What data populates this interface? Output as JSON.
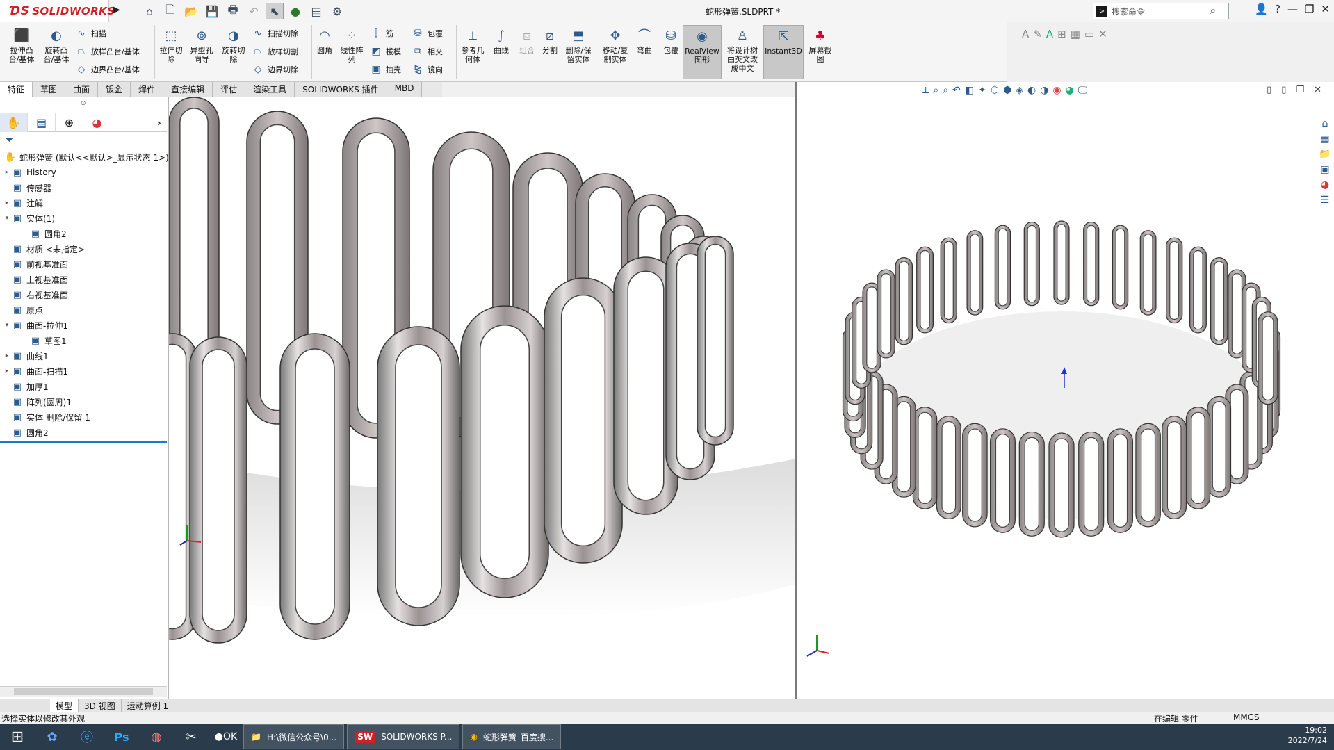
{
  "app": {
    "logo": "SOLIDWORKS",
    "doc_title": "蛇形弹簧.SLDPRT *"
  },
  "search": {
    "placeholder": "搜索命令"
  },
  "ribbon": {
    "extrude_boss": "拉伸凸\n台/基体",
    "revolve_boss": "旋转凸\n台/基体",
    "sweep": "扫描",
    "loft_boss": "放样凸台/基体",
    "boundary_boss": "边界凸台/基体",
    "extrude_cut": "拉伸切\n除",
    "hole_wizard": "异型孔\n向导",
    "revolve_cut": "旋转切\n除",
    "swept_cut": "扫描切除",
    "lofted_cut": "放样切割",
    "boundary_cut": "边界切除",
    "fillet": "圆角",
    "linear_pattern": "线性阵\n列",
    "rib": "筋",
    "draft": "拔模",
    "shell": "抽壳",
    "wrap": "包覆",
    "intersect": "相交",
    "mirror": "镜向",
    "ref_geometry": "参考几\n何体",
    "curves": "曲线",
    "combine": "组合",
    "split": "分割",
    "delete_keep": "删除/保\n留实体",
    "move_copy": "移动/复\n制实体",
    "flex": "弯曲",
    "wrap2": "包覆",
    "realview": "RealView\n图形",
    "translate": "将设计树\n由英文改\n成中文",
    "instant3d": "Instant3D",
    "screenshot": "屏幕截\n图"
  },
  "tabs": [
    "特征",
    "草图",
    "曲面",
    "钣金",
    "焊件",
    "直接编辑",
    "评估",
    "渲染工具",
    "SOLIDWORKS 插件",
    "MBD"
  ],
  "tree": {
    "root": "蛇形弹簧 (默认<<默认>_显示状态 1>)",
    "items": [
      {
        "label": "History",
        "icon": "history-icon",
        "indent": 1,
        "expand": "▸"
      },
      {
        "label": "传感器",
        "icon": "sensor-icon",
        "indent": 1,
        "expand": ""
      },
      {
        "label": "注解",
        "icon": "annotation-icon",
        "indent": 1,
        "expand": "▸"
      },
      {
        "label": "实体(1)",
        "icon": "solid-bodies-icon",
        "indent": 1,
        "expand": "▾"
      },
      {
        "label": "圆角2",
        "icon": "body-icon",
        "indent": 2,
        "expand": ""
      },
      {
        "label": "材质 <未指定>",
        "icon": "material-icon",
        "indent": 1,
        "expand": ""
      },
      {
        "label": "前视基准面",
        "icon": "plane-icon",
        "indent": 1,
        "expand": ""
      },
      {
        "label": "上视基准面",
        "icon": "plane-icon",
        "indent": 1,
        "expand": ""
      },
      {
        "label": "右视基准面",
        "icon": "plane-icon",
        "indent": 1,
        "expand": ""
      },
      {
        "label": "原点",
        "icon": "origin-icon",
        "indent": 1,
        "expand": ""
      },
      {
        "label": "曲面-拉伸1",
        "icon": "surface-extrude-icon",
        "indent": 1,
        "expand": "▾"
      },
      {
        "label": "草图1",
        "icon": "sketch-icon",
        "indent": 2,
        "expand": ""
      },
      {
        "label": "曲线1",
        "icon": "curve-icon",
        "indent": 1,
        "expand": "▸"
      },
      {
        "label": "曲面-扫描1",
        "icon": "surface-sweep-icon",
        "indent": 1,
        "expand": "▸"
      },
      {
        "label": "加厚1",
        "icon": "thicken-icon",
        "indent": 1,
        "expand": ""
      },
      {
        "label": "阵列(圆周)1",
        "icon": "circular-pattern-icon",
        "indent": 1,
        "expand": ""
      },
      {
        "label": "实体-删除/保留 1",
        "icon": "delete-body-icon",
        "indent": 1,
        "expand": ""
      },
      {
        "label": "圆角2",
        "icon": "fillet-icon",
        "indent": 1,
        "expand": ""
      }
    ]
  },
  "bottom_tabs": [
    "模型",
    "3D 视图",
    "运动算例 1"
  ],
  "status": {
    "left": "选择实体以修改其外观",
    "editing": "在编辑 零件",
    "units": "MMGS"
  },
  "taskbar": {
    "apps": [
      {
        "label": "H:\\微信公众号\\0...",
        "icon": "folder-icon"
      },
      {
        "label": "SOLIDWORKS P...",
        "icon": "solidworks-icon"
      },
      {
        "label": "蛇形弹簧_百度搜...",
        "icon": "chrome-icon"
      }
    ],
    "time": "19:02",
    "date": "2022/7/24"
  }
}
